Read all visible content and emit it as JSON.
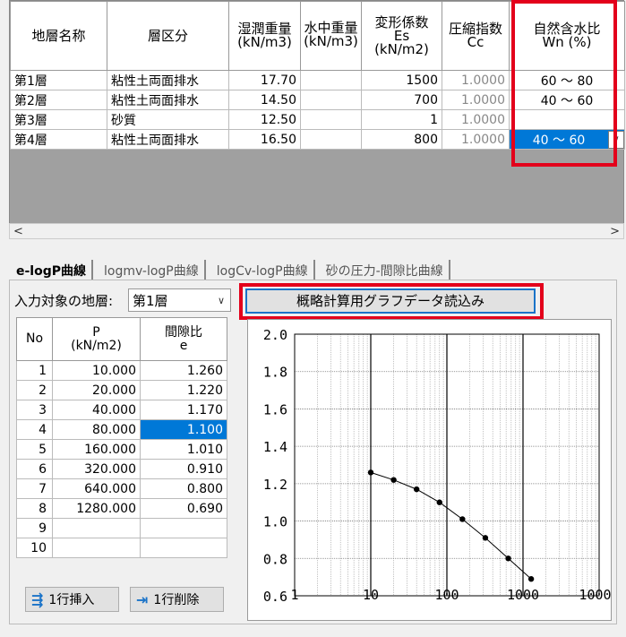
{
  "layers": {
    "headers": {
      "name": "地層名称",
      "category": "層区分",
      "wet_weight": [
        "湿潤重量",
        "(kN/m3)"
      ],
      "submerged_weight": [
        "水中重量",
        "(kN/m3)"
      ],
      "modulus": [
        "変形係数",
        "Es",
        "(kN/m2)"
      ],
      "compression": [
        "圧縮指数",
        "Cc"
      ],
      "water_content": [
        "自然含水比",
        "Wn (%)"
      ]
    },
    "rows": [
      {
        "name": "第1層",
        "category": "粘性土両面排水",
        "wet": "17.70",
        "sub": "",
        "es": "1500",
        "cc": "1.0000",
        "wn": "60 ～ 80"
      },
      {
        "name": "第2層",
        "category": "粘性土両面排水",
        "wet": "14.50",
        "sub": "",
        "es": "700",
        "cc": "1.0000",
        "wn": "40 ～ 60"
      },
      {
        "name": "第3層",
        "category": "砂質",
        "wet": "12.50",
        "sub": "",
        "es": "1",
        "cc": "1.0000",
        "wn": ""
      },
      {
        "name": "第4層",
        "category": "粘性土両面排水",
        "wet": "16.50",
        "sub": "",
        "es": "800",
        "cc": "1.0000",
        "wn": "40 ～ 60"
      }
    ],
    "scroll_left": "<",
    "scroll_right": ">"
  },
  "tabs": [
    {
      "label": "e-logP曲線",
      "active": true
    },
    {
      "label": "logmv-logP曲線",
      "active": false
    },
    {
      "label": "logCv-logP曲線",
      "active": false
    },
    {
      "label": "砂の圧力-間隙比曲線",
      "active": false
    }
  ],
  "target_label": "入力対象の地層:",
  "target_value": "第1層",
  "load_button": "概略計算用グラフデータ読込み",
  "points": {
    "headers": {
      "no": "No",
      "p": [
        "P",
        "(kN/m2)"
      ],
      "e": [
        "間隙比",
        "e"
      ]
    },
    "rows": [
      {
        "no": "1",
        "p": "10.000",
        "e": "1.260"
      },
      {
        "no": "2",
        "p": "20.000",
        "e": "1.220"
      },
      {
        "no": "3",
        "p": "40.000",
        "e": "1.170"
      },
      {
        "no": "4",
        "p": "80.000",
        "e": "1.100"
      },
      {
        "no": "5",
        "p": "160.000",
        "e": "1.010"
      },
      {
        "no": "6",
        "p": "320.000",
        "e": "0.910"
      },
      {
        "no": "7",
        "p": "640.000",
        "e": "0.800"
      },
      {
        "no": "8",
        "p": "1280.000",
        "e": "0.690"
      },
      {
        "no": "9",
        "p": "",
        "e": ""
      },
      {
        "no": "10",
        "p": "",
        "e": ""
      }
    ]
  },
  "insert_button": "1行挿入",
  "delete_button": "1行削除",
  "chart_data": {
    "type": "scatter",
    "x": [
      10,
      20,
      40,
      80,
      160,
      320,
      640,
      1280
    ],
    "y": [
      1.26,
      1.22,
      1.17,
      1.1,
      1.01,
      0.91,
      0.8,
      0.69
    ],
    "x_scale": "log",
    "xlim": [
      1,
      10000
    ],
    "ylim": [
      0.6,
      2.0
    ],
    "xticks": [
      "1",
      "10",
      "100",
      "1000",
      "10000"
    ],
    "yticks": [
      "2.0",
      "1.8",
      "1.6",
      "1.4",
      "1.2",
      "1.0",
      "0.8",
      "0.6"
    ],
    "grid": true,
    "line_color": "#000000"
  },
  "colors": {
    "highlight": "#e3001b",
    "selection": "#0078d7"
  }
}
